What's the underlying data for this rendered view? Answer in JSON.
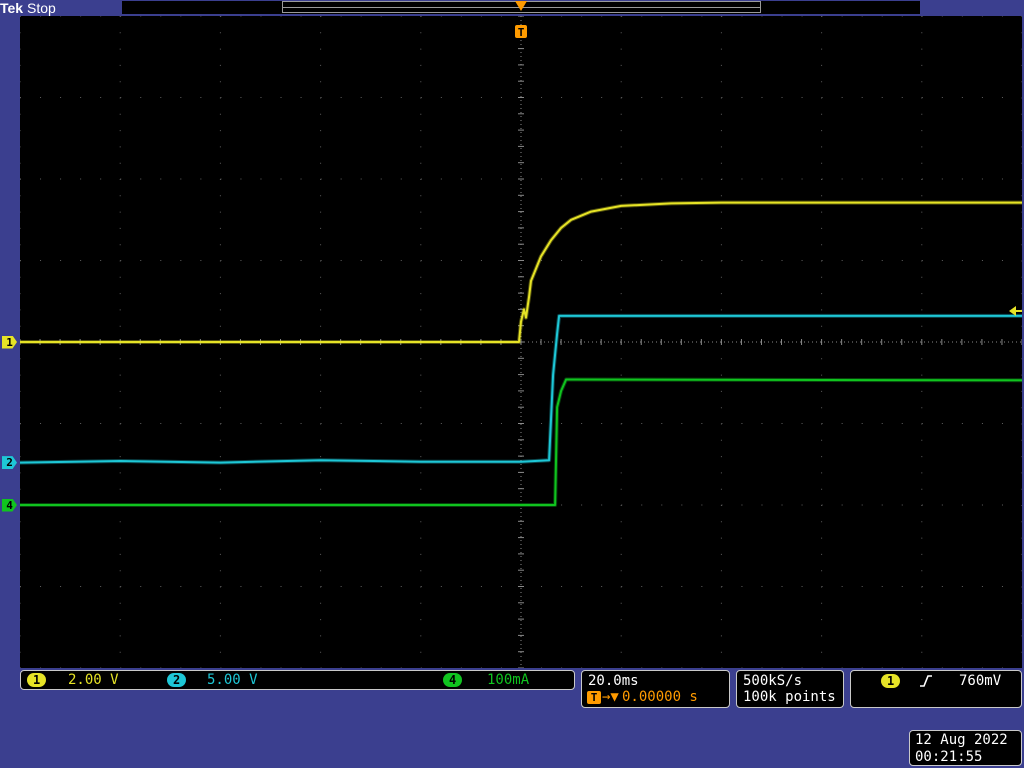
{
  "header": {
    "brand": "Tek",
    "status": "Stop"
  },
  "colors": {
    "ch1": "#e6e326",
    "ch2": "#1ec7d6",
    "ch4": "#10c41f",
    "trigger": "#ff9b00",
    "grid": "#5f5f5f"
  },
  "markers": {
    "ch1": "1",
    "ch2": "2",
    "ch4": "4",
    "trigger": "T"
  },
  "readouts": {
    "ch1": {
      "id": "1",
      "scale": "2.00 V"
    },
    "ch2": {
      "id": "2",
      "scale": "5.00 V"
    },
    "ch4": {
      "id": "4",
      "scale": "100mA"
    },
    "timebase": {
      "scale": "20.0ms",
      "trigger_pos": "0.00000 s"
    },
    "acquisition": {
      "rate": "500kS/s",
      "length": "100k points"
    },
    "trigger": {
      "source": "1",
      "level": "760mV"
    }
  },
  "datetime": {
    "date": "12 Aug 2022",
    "time": "00:21:55"
  },
  "chart_data": {
    "type": "line",
    "xlabel": "",
    "ylabel": "",
    "x_unit": "divisions",
    "y_unit": "divisions",
    "xlim": [
      -5,
      5
    ],
    "ylim": [
      -4,
      4
    ],
    "grid": true,
    "series": [
      {
        "key": "ch1",
        "x": [
          -5,
          -0.02,
          0.0,
          0.03,
          0.05,
          0.08,
          0.1,
          0.2,
          0.3,
          0.4,
          0.5,
          0.7,
          1.0,
          1.5,
          2.0,
          3.0,
          5.0
        ],
        "y": [
          0.0,
          0.0,
          0.25,
          0.4,
          0.3,
          0.55,
          0.75,
          1.05,
          1.25,
          1.4,
          1.5,
          1.6,
          1.67,
          1.7,
          1.71,
          1.71,
          1.71
        ]
      },
      {
        "key": "ch2",
        "x": [
          -5,
          -4,
          -3,
          -2,
          -1,
          0,
          0.28,
          0.32,
          0.36,
          0.38,
          5.0
        ],
        "y": [
          -1.48,
          -1.46,
          -1.48,
          -1.45,
          -1.47,
          -1.47,
          -1.45,
          -0.4,
          0.1,
          0.32,
          0.32
        ]
      },
      {
        "key": "ch4",
        "x": [
          -5,
          0.34,
          0.36,
          0.4,
          0.45,
          0.5,
          5.0
        ],
        "y": [
          -2.0,
          -2.0,
          -0.8,
          -0.6,
          -0.46,
          -0.46,
          -0.47
        ]
      }
    ]
  }
}
